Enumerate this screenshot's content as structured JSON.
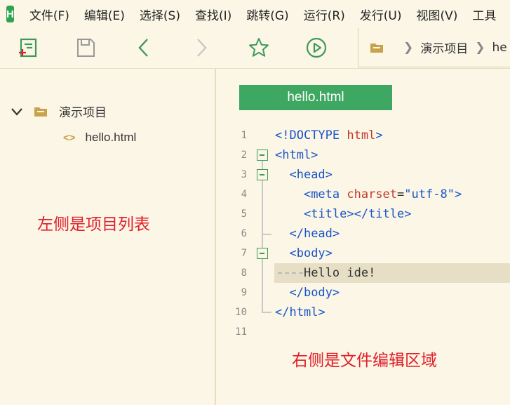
{
  "app": {
    "logo_letter": "H"
  },
  "menu": [
    "文件(F)",
    "编辑(E)",
    "选择(S)",
    "查找(I)",
    "跳转(G)",
    "运行(R)",
    "发行(U)",
    "视图(V)",
    "工具"
  ],
  "toolbar": {
    "buttons": [
      "new-file-icon",
      "save-icon",
      "back-icon",
      "forward-icon",
      "star-icon",
      "run-icon"
    ]
  },
  "breadcrumb": {
    "project": "演示项目",
    "file_partial": "he"
  },
  "sidebar": {
    "project_name": "演示项目",
    "file_icon": "<>",
    "file_name": "hello.html",
    "annotation": "左侧是项目列表"
  },
  "editor": {
    "tab_title": "hello.html",
    "annotation": "右侧是文件编辑区域",
    "line_numbers": [
      "1",
      "2",
      "3",
      "4",
      "5",
      "6",
      "7",
      "8",
      "9",
      "10",
      "11"
    ]
  },
  "colors": {
    "accent_green": "#3ea862",
    "annotation_red": "#e0202a",
    "background": "#fbf6e6"
  }
}
